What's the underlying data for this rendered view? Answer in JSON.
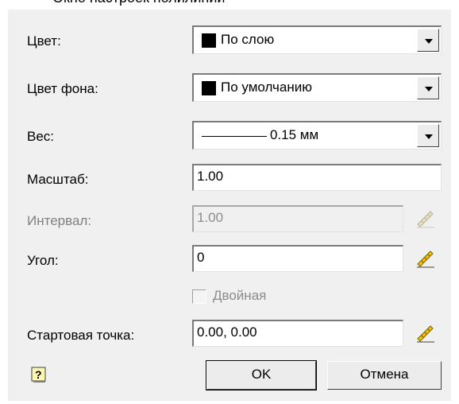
{
  "top_fragment": "Окно настроек полилинии",
  "fields": {
    "color_label": "Цвет:",
    "color_value": "По слою",
    "bgcolor_label": "Цвет фона:",
    "bgcolor_value": "По умолчанию",
    "weight_label": "Вес:",
    "weight_value": "0.15 мм",
    "scale_label": "Масштаб:",
    "scale_value": "1.00",
    "interval_label": "Интервал:",
    "interval_value": "1.00",
    "angle_label": "Угол:",
    "angle_value": "0",
    "double_label": "Двойная",
    "double_checked": false,
    "start_label": "Стартовая точка:",
    "start_value": "0.00, 0.00"
  },
  "buttons": {
    "ok": "OK",
    "cancel": "Отмена"
  },
  "colors": {
    "dialog_bg": "#f0f0f0",
    "disabled_text": "#8c8c8c",
    "swatch": "#000000"
  },
  "icons": {
    "dropdown": "chevron-down-icon",
    "pick": "ruler-pencil-icon",
    "help": "help-icon"
  }
}
